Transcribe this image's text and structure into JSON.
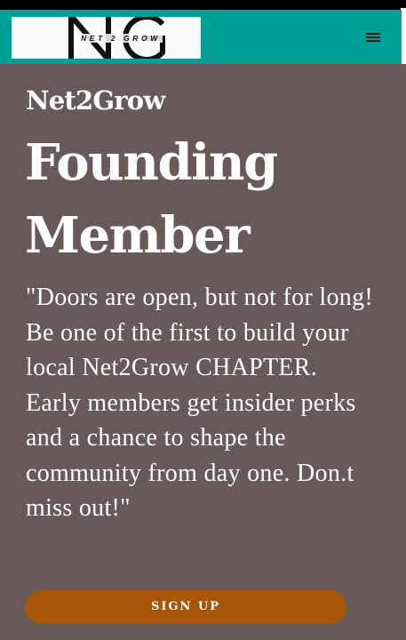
{
  "header": {
    "logo_text": "NET 2 GROW",
    "menu_icon": "hamburger-menu-icon",
    "background_color": "#009f95"
  },
  "hero": {
    "kicker": "Net2Grow",
    "title": "Founding Member",
    "body": "\"Doors are open, but not for long! Be one of the first to build your local Net2Grow CHAPTER. Early members get insider perks and a chance to shape the community from day one. Don.t miss out!\"",
    "background_color": "#685a5a"
  },
  "cta": {
    "label": "SIGN UP",
    "color": "#a75507"
  }
}
